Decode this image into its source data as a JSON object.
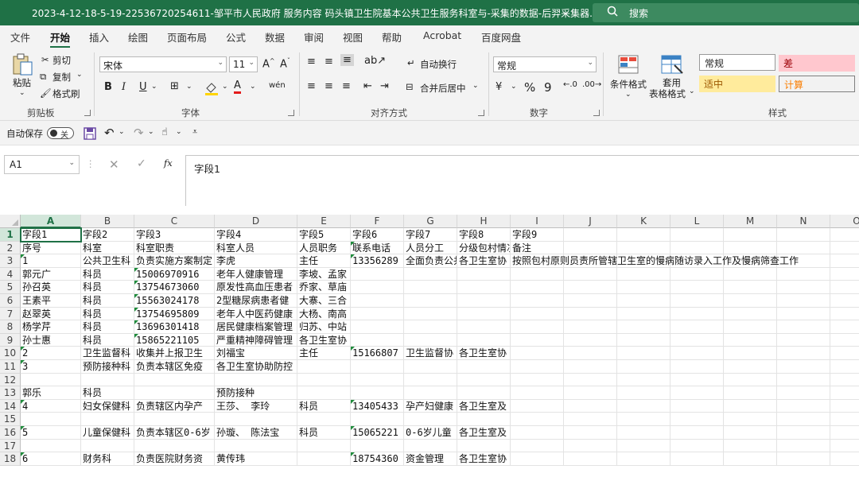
{
  "titlebar": {
    "title": "2023-4-12-18-5-19-22536720254611-邹平市人民政府 服务内容 码头镇卫生院基本公共卫生服务科室与-采集的数据-后羿采集器.x...",
    "search": "搜索"
  },
  "menu": [
    "文件",
    "开始",
    "插入",
    "绘图",
    "页面布局",
    "公式",
    "数据",
    "审阅",
    "视图",
    "帮助",
    "Acrobat",
    "百度网盘"
  ],
  "ribbon": {
    "clipboard": {
      "paste": "粘贴",
      "cut": "剪切",
      "copy": "复制",
      "format_painter": "格式刷",
      "label": "剪贴板"
    },
    "font": {
      "name": "宋体",
      "size": "11",
      "bold": "B",
      "italic": "I",
      "underline": "U",
      "label": "字体",
      "grow": "A^",
      "shrink": "Aˇ",
      "font_color": "A"
    },
    "alignment": {
      "wrap": "自动换行",
      "merge": "合并后居中",
      "label": "对齐方式"
    },
    "number": {
      "format": "常规",
      "label": "数字",
      "percent": "%",
      "comma": "9"
    },
    "styles": {
      "cond": "条件格式",
      "table1": "套用",
      "table2": "表格格式",
      "label": "样式",
      "normal": "常规",
      "bad": "差",
      "neutral": "适中",
      "calc": "计算"
    }
  },
  "qat": {
    "autosave": "自动保存",
    "toggle": "关"
  },
  "formula_bar": {
    "name_box": "A1",
    "fx": "fx",
    "content": "字段1"
  },
  "columns": [
    "A",
    "B",
    "C",
    "D",
    "E",
    "F",
    "G",
    "H",
    "I",
    "J",
    "K",
    "L",
    "M",
    "N",
    "O"
  ],
  "rows": [
    {
      "n": "1",
      "cells": [
        "字段1",
        "字段2",
        "字段3",
        "字段4",
        "字段5",
        "字段6",
        "字段7",
        "字段8",
        "字段9"
      ]
    },
    {
      "n": "2",
      "cells": [
        "序号",
        "科室",
        "科室职责",
        "科室人员",
        "人员职务",
        "联系电话",
        "人员分工",
        "分级包村情况",
        "备注"
      ]
    },
    {
      "n": "3",
      "cells": [
        "1",
        "公共卫生科",
        "负责实施方案制定",
        "李虎",
        "主任",
        "13356289",
        "全面负责公共",
        "各卫生室协",
        "按照包村原则员责所管辖卫生室的慢病随访录入工作及慢病筛查工作"
      ]
    },
    {
      "n": "4",
      "cells": [
        "郭元广",
        "科员",
        "15006970916",
        "老年人健康管理",
        "李坡、孟家",
        "",
        "",
        "",
        ""
      ]
    },
    {
      "n": "5",
      "cells": [
        "孙召英",
        "科员",
        "13754673060",
        "原发性高血压患者",
        "乔家、草庙",
        "",
        "",
        "",
        ""
      ]
    },
    {
      "n": "6",
      "cells": [
        "王素平",
        "科员",
        "15563024178",
        "2型糖尿病患者健",
        "大寨、三合",
        "",
        "",
        "",
        ""
      ]
    },
    {
      "n": "7",
      "cells": [
        "赵翠英",
        "科员",
        "13754695809",
        "老年人中医药健康",
        "大杨、南高",
        "",
        "",
        "",
        ""
      ]
    },
    {
      "n": "8",
      "cells": [
        "杨学芹",
        "科员",
        "13696301418",
        "居民健康档案管理",
        "归苏、中站",
        "",
        "",
        "",
        ""
      ]
    },
    {
      "n": "9",
      "cells": [
        "孙士惠",
        "科员",
        "15865221105",
        "严重精神障碍管理",
        "各卫生室协",
        "",
        "",
        "",
        ""
      ]
    },
    {
      "n": "10",
      "cells": [
        "2",
        "卫生监督科",
        "收集并上报卫生",
        "刘福宝",
        "主任",
        "15166807",
        "卫生监督协",
        "各卫生室协",
        ""
      ]
    },
    {
      "n": "11",
      "cells": [
        "3",
        "预防接种科",
        "负责本辖区免疫",
        "各卫生室协助防控",
        "",
        "",
        "",
        "",
        ""
      ]
    },
    {
      "n": "12",
      "cells": [
        "",
        "",
        "",
        "",
        "",
        "",
        "",
        "",
        ""
      ]
    },
    {
      "n": "13",
      "cells": [
        "郭乐",
        "科员",
        "",
        "预防接种",
        "",
        "",
        "",
        "",
        ""
      ]
    },
    {
      "n": "14",
      "cells": [
        "4",
        "妇女保健科",
        "负责辖区内孕产",
        "王莎、    李玲",
        "科员",
        "13405433",
        "孕产妇健康",
        "各卫生室及",
        ""
      ]
    },
    {
      "n": "15",
      "cells": [
        "",
        "",
        "",
        "",
        "",
        "",
        "",
        "",
        ""
      ]
    },
    {
      "n": "16",
      "cells": [
        "5",
        "儿童保健科",
        "负责本辖区0-6岁",
        "孙璇、    陈法宝",
        "科员",
        "15065221",
        "0-6岁儿童",
        "各卫生室及",
        ""
      ]
    },
    {
      "n": "17",
      "cells": [
        "",
        "",
        "",
        "",
        "",
        "",
        "",
        "",
        ""
      ]
    },
    {
      "n": "18",
      "cells": [
        "6",
        "财务科",
        "负责医院财务资",
        "黄传玮",
        "",
        "18754360",
        "资金管理",
        "各卫生室协",
        ""
      ]
    }
  ]
}
